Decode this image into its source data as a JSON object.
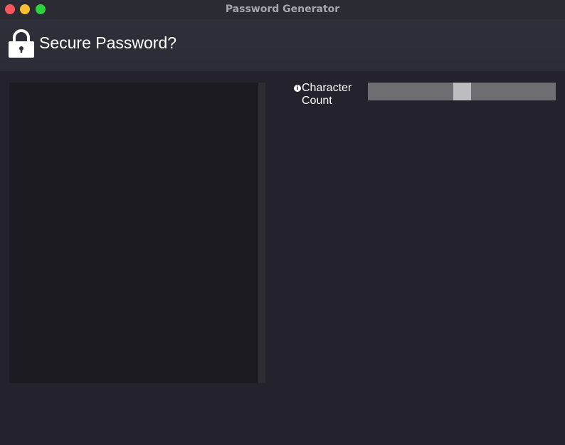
{
  "window": {
    "title": "Password Generator"
  },
  "header": {
    "title": "Secure Password?",
    "icon": "lock-icon"
  },
  "output": {
    "text": ""
  },
  "settings": {
    "character_count": {
      "label": "Character Count",
      "info_icon": "info-icon",
      "value_fraction": 0.5
    }
  }
}
